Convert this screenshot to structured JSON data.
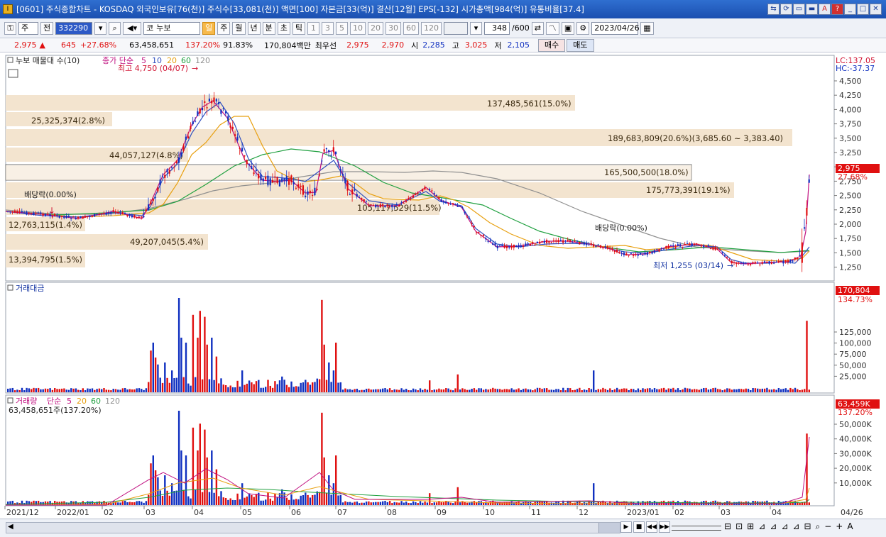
{
  "titlebar": {
    "title": "[0601] 주식종합차트 - KOSDAQ 외국인보유[76(천)] 주식수[33,081(천)] 액면[100] 자본금[33(억)] 결산[12월] EPS[-132] 시가총액[984(억)] 유통비율[37.4]",
    "buttons": [
      "⇆",
      "⟳",
      "▭",
      "▬",
      "A",
      "?",
      "_",
      "□",
      "✕"
    ]
  },
  "toolbar": {
    "market": "주",
    "all": "전",
    "code": "332290",
    "name_prefix": "코",
    "name": "누보",
    "period_buttons": [
      "일",
      "주",
      "월",
      "년",
      "분",
      "초",
      "틱"
    ],
    "period_selected": "일",
    "interval_buttons": [
      "1",
      "3",
      "5",
      "10",
      "20",
      "30",
      "60",
      "120"
    ],
    "count": "348",
    "count_total": "/600",
    "date": "2023/04/26"
  },
  "quote": {
    "price": "2,975",
    "arrow": "▲",
    "change": "645",
    "change_pct": "+27.68%",
    "volume": "63,458,651",
    "volume_pct": "137.20%",
    "turnover_pct": "91.83%",
    "amount": "170,804백만",
    "priority_label": "최우선",
    "ask": "2,975",
    "bid": "2,970",
    "open_label": "시",
    "open": "2,285",
    "high_label": "고",
    "high": "3,025",
    "low_label": "저",
    "low": "2,105",
    "buy_label": "매수",
    "sell_label": "매도"
  },
  "price_panel": {
    "legend_name": "누보 매물대 수(10)",
    "legend_ma": "종가 단순",
    "ma_periods": [
      "5",
      "10",
      "20",
      "60",
      "120"
    ],
    "lc_label": "LC:137.05",
    "hc_label": "HC:-37.37",
    "high_marker": "최고 4,750 (04/07)",
    "low_marker": "최저 1,255 (03/14)",
    "dividend_marker": "배당락(0.00%)",
    "current_price_tag": "2,975",
    "current_pct_tag": "27.68%",
    "y_ticks": [
      "4,500",
      "4,250",
      "4,000",
      "3,750",
      "3,500",
      "3,250",
      "3,000",
      "2,750",
      "2,500",
      "2,250",
      "2,000",
      "1,750",
      "1,500",
      "1,250"
    ],
    "profile_labels": [
      "137,485,561(15.0%)",
      "25,325,374(2.8%)",
      "189,683,809(20.6%)(3,685.60 ~ 3,383.40)",
      "44,057,127(4.8%)",
      "165,500,500(18.0%)",
      "175,773,391(19.1%)",
      "105,117,529(11.5%)",
      "12,763,115(1.4%)",
      "49,207,045(5.4%)",
      "13,394,795(1.5%)"
    ]
  },
  "amount_panel": {
    "legend": "거래대금",
    "current_tag": "170,804",
    "pct_tag": "134.73%",
    "y_ticks": [
      "125,000",
      "100,000",
      "75,000",
      "50,000",
      "25,000"
    ]
  },
  "volume_panel": {
    "legend_name": "거래량",
    "legend_ma": "단순",
    "ma_periods": [
      "5",
      "20",
      "60",
      "120"
    ],
    "value_line": "63,458,651주(137.20%)",
    "current_tag": "63,459K",
    "pct_tag": "137.20%",
    "y_ticks": [
      "50,000K",
      "40,000K",
      "30,000K",
      "20,000K",
      "10,000K"
    ]
  },
  "x_axis": {
    "labels": [
      "2021/12",
      "2022/01",
      "02",
      "03",
      "04",
      "05",
      "06",
      "07",
      "08",
      "09",
      "10",
      "11",
      "12",
      "2023/01",
      "02",
      "03",
      "04"
    ],
    "last_date": "04/26"
  },
  "colors": {
    "up": "#e01010",
    "down": "#1030c0",
    "ma5": "#c01080",
    "ma10": "#3050c0",
    "ma20": "#e8a010",
    "ma60": "#20a040",
    "ma120": "#909090",
    "profile": "#f3e4cf"
  },
  "bottom": {
    "zoom_tools": [
      "⊟",
      "⊡",
      "⊞",
      "⊿",
      "⊿",
      "⊿",
      "⊿",
      "⊟",
      "⌕",
      "−",
      "+",
      "A"
    ]
  }
}
